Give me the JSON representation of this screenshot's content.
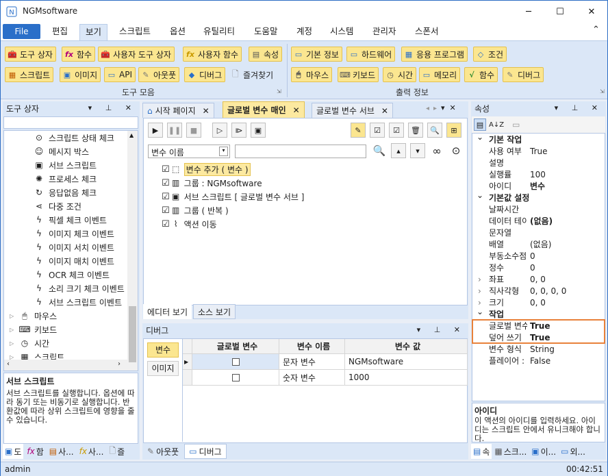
{
  "app": {
    "title": "NGMsoftware",
    "minimize": "─",
    "maximize": "☐",
    "close": "✕",
    "ribbon_collapse": "⌃"
  },
  "menu": {
    "file": "File",
    "items": [
      "편집",
      "보기",
      "스크립트",
      "옵션",
      "유틸리티",
      "도움말",
      "계정",
      "시스템",
      "관리자",
      "스폰서"
    ],
    "active": "보기"
  },
  "ribbon": {
    "tools_row1": [
      "도구 상자",
      "함수",
      "사용자 도구 상자",
      "사용자 함수",
      "속성"
    ],
    "tools_row2": [
      "스크립트",
      "이미지",
      "API",
      "아웃풋",
      "디버그",
      "즐겨찾기"
    ],
    "tools_group": "도구 모음",
    "output_row1": [
      "기본 정보",
      "하드웨어",
      "응용 프로그램",
      "조건"
    ],
    "output_row2": [
      "마우스",
      "키보드",
      "시간",
      "메모리",
      "함수",
      "디버그"
    ],
    "output_group": "출력 정보"
  },
  "toolbox": {
    "title": "도구 상자",
    "items": [
      {
        "label": "스크립트 상태 체크",
        "icon": "code-circle-icon"
      },
      {
        "label": "메시지 박스",
        "icon": "message-box-icon"
      },
      {
        "label": "서브 스크립트",
        "icon": "sub-script-icon"
      },
      {
        "label": "프로세스 체크",
        "icon": "process-bulb-icon"
      },
      {
        "label": "응답없음 체크",
        "icon": "refresh-icon"
      },
      {
        "label": "다중 조건",
        "icon": "share-icon"
      },
      {
        "label": "픽셀 체크 이벤트",
        "icon": "lightning-icon"
      },
      {
        "label": "이미지 체크 이벤트",
        "icon": "lightning-icon"
      },
      {
        "label": "이미지 서치 이벤트",
        "icon": "lightning-icon"
      },
      {
        "label": "이미지 매치 이벤트",
        "icon": "lightning-icon"
      },
      {
        "label": "OCR 체크 이벤트",
        "icon": "lightning-icon"
      },
      {
        "label": "소리 크기 체크 이벤트",
        "icon": "lightning-icon"
      },
      {
        "label": "서브 스크립트 이벤트",
        "icon": "lightning-icon"
      }
    ],
    "categories": [
      {
        "label": "마우스",
        "icon": "mouse-icon"
      },
      {
        "label": "키보드",
        "icon": "keyboard-icon"
      },
      {
        "label": "시간",
        "icon": "clock-icon"
      },
      {
        "label": "스크립트",
        "icon": "script-icon"
      }
    ],
    "desc_title": "서브 스크립트",
    "desc_text": "서브 스크립트를 실행합니다. 옵션에 따라 동기 또는 비동기로 실행합니다. 반환값에 따라 상위 스크립트에 영향을 줄 수 있습니다.",
    "bottom_tabs": [
      "도",
      "함",
      "사...",
      "사...",
      "즐"
    ]
  },
  "editor": {
    "tabs": [
      {
        "label": "시작 페이지",
        "active": false
      },
      {
        "label": "글로벌 변수 매인",
        "active": true
      },
      {
        "label": "글로벌 변수 서브",
        "active": false
      }
    ],
    "var_select": "변수 이름",
    "search_value": "",
    "tree": [
      {
        "label": "변수 추가 ( 변수 )",
        "icon": "cube-icon",
        "selected": true
      },
      {
        "label": "그룹 : NGMsoftware",
        "icon": "group-icon",
        "selected": false
      },
      {
        "label": "서브 스크립트 [ 글로벌 변수 서브 ]",
        "icon": "sub-script-icon",
        "selected": false
      },
      {
        "label": "그룹 ( 반복 )",
        "icon": "group-icon",
        "selected": false
      },
      {
        "label": "액션 이동",
        "icon": "move-action-icon",
        "selected": false
      }
    ],
    "bottom_tabs": [
      "에디터 보기",
      "소스 보기"
    ]
  },
  "debug": {
    "title": "디버그",
    "side_buttons": [
      "변수",
      "이미지"
    ],
    "columns": [
      "글로벌 변수",
      "변수 이름",
      "변수 값"
    ],
    "rows": [
      {
        "global": false,
        "name": "문자 변수",
        "value": "NGMsoftware"
      },
      {
        "global": false,
        "name": "숫자 변수",
        "value": "1000"
      }
    ],
    "bottom_tabs": [
      "아웃풋",
      "디버그"
    ]
  },
  "properties": {
    "title": "속성",
    "groups": [
      {
        "name": "기본 작업",
        "rows": [
          [
            "사용 여부",
            "True",
            false
          ],
          [
            "설명",
            "",
            false
          ],
          [
            "실행률",
            "100",
            false
          ],
          [
            "아이디",
            "변수",
            true
          ]
        ]
      },
      {
        "name": "기본값 설정",
        "rows": [
          [
            "날짜시간",
            "",
            false
          ],
          [
            "데이터 테이",
            "(없음)",
            true
          ],
          [
            "문자열",
            "",
            false
          ],
          [
            "배열",
            "(없음)",
            false
          ],
          [
            "부동소수점",
            "0",
            false
          ],
          [
            "정수",
            "0",
            false
          ],
          [
            "좌표",
            "0, 0",
            false
          ],
          [
            "직사각형",
            "0, 0, 0, 0",
            false
          ],
          [
            "크기",
            "0, 0",
            false
          ]
        ]
      },
      {
        "name": "작업",
        "rows": [
          [
            "글로벌 변수",
            "True",
            true
          ],
          [
            "덮어 쓰기",
            "True",
            true
          ],
          [
            "변수 형식",
            "String",
            false
          ],
          [
            "플레이어 :",
            "False",
            false
          ]
        ]
      }
    ],
    "desc_title": "아이디",
    "desc_text": "이 액션의 아이디를 입력하세요. 아이디는 스크립트 안에서 유니크해야 합니다.",
    "bottom_tabs": [
      "속",
      "스크...",
      "이...",
      "외..."
    ]
  },
  "status": {
    "user": "admin",
    "time": "00:42:51"
  },
  "colors": {
    "accent": "#2a6fc9",
    "ribbon_btn": "#fbe690",
    "highlight_box": "#e8813a",
    "panel_header": "#dbe7f7"
  }
}
